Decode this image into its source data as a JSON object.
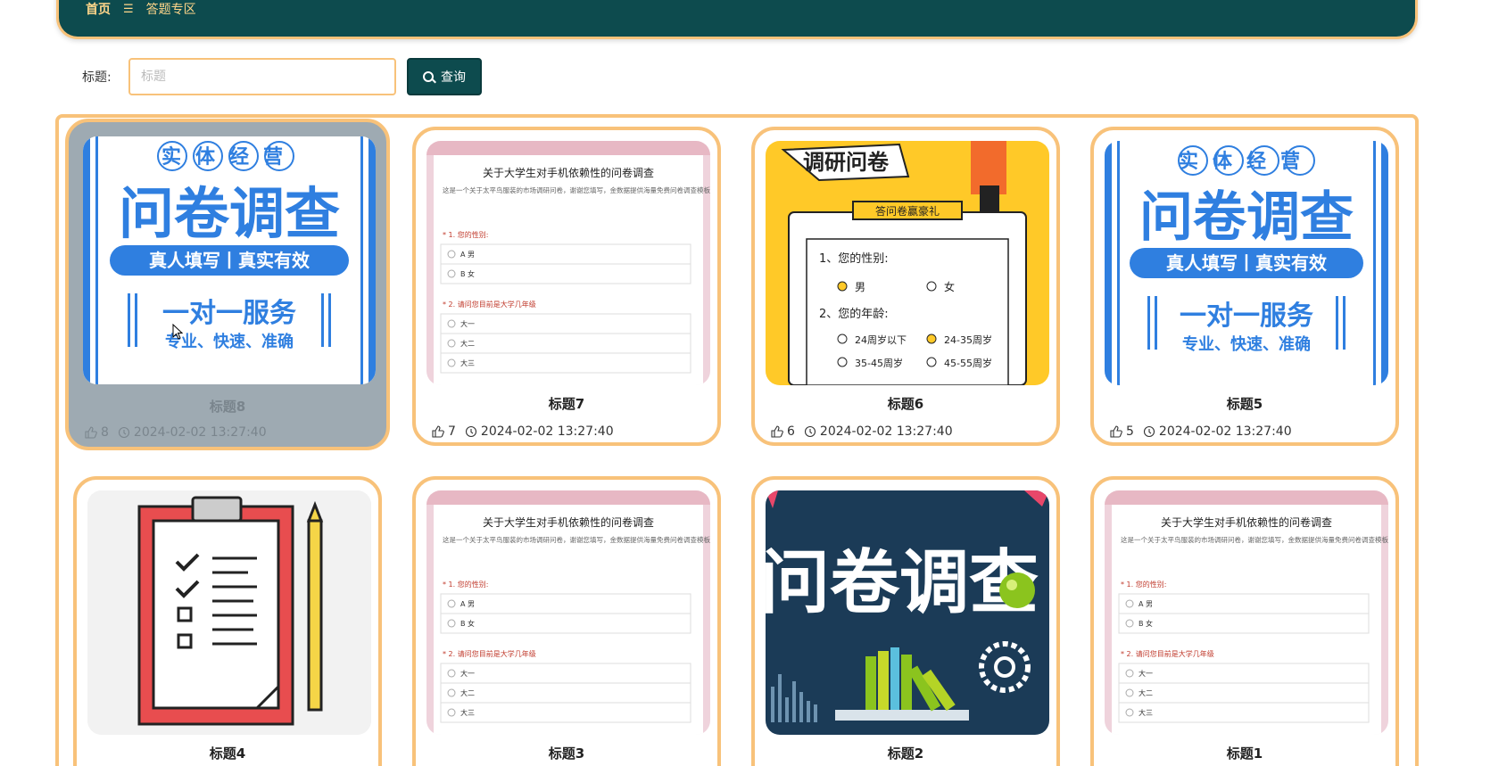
{
  "nav": {
    "home": "首页",
    "separator": "☰",
    "current": "答题专区"
  },
  "search": {
    "label": "标题:",
    "placeholder": "标题",
    "value": "",
    "button": "查询"
  },
  "cards": [
    {
      "title": "标题8",
      "likes": "8",
      "time": "2024-02-02 13:27:40",
      "image": "survey-poster-blue"
    },
    {
      "title": "标题7",
      "likes": "7",
      "time": "2024-02-02 13:27:40",
      "image": "questionnaire-form"
    },
    {
      "title": "标题6",
      "likes": "6",
      "time": "2024-02-02 13:27:40",
      "image": "survey-yellow-cartoon"
    },
    {
      "title": "标题5",
      "likes": "5",
      "time": "2024-02-02 13:27:40",
      "image": "survey-poster-blue"
    },
    {
      "title": "标题4",
      "image": "clipboard-checklist"
    },
    {
      "title": "标题3",
      "image": "questionnaire-form"
    },
    {
      "title": "标题2",
      "image": "survey-dark-books"
    },
    {
      "title": "标题1",
      "image": "questionnaire-form"
    }
  ],
  "poster": {
    "top": "实体经营",
    "main": "问卷调查",
    "banner": "真人填写丨真实有效",
    "service": "一对一服务",
    "tagline": "专业、快速、准确"
  },
  "form": {
    "heading": "关于大学生对手机依赖性的问卷调查",
    "intro": "这是一个关于太平鸟服装的市场调研问卷，谢谢您填写，金数据提供海量免费问卷调查模板！",
    "q1": "* 1. 您的性别:",
    "q1_a": "A 男",
    "q1_b": "B 女",
    "q2": "* 2. 请问您目前是大学几年级",
    "q2_a": "大一",
    "q2_b": "大二",
    "q2_c": "大三"
  },
  "yellow": {
    "title": "调研问卷",
    "banner": "答问卷赢豪礼",
    "q1": "1、您的性别:",
    "male": "男",
    "female": "女",
    "q2": "2、您的年龄:",
    "age1": "24周岁以下",
    "age2": "24-35周岁",
    "age3": "35-45周岁",
    "age4": "45-55周岁"
  },
  "dark": {
    "main": "问卷调查"
  },
  "colors": {
    "accent": "#f8c27a",
    "primary": "#0d4b4e",
    "poster_blue": "#2f7fe0"
  }
}
